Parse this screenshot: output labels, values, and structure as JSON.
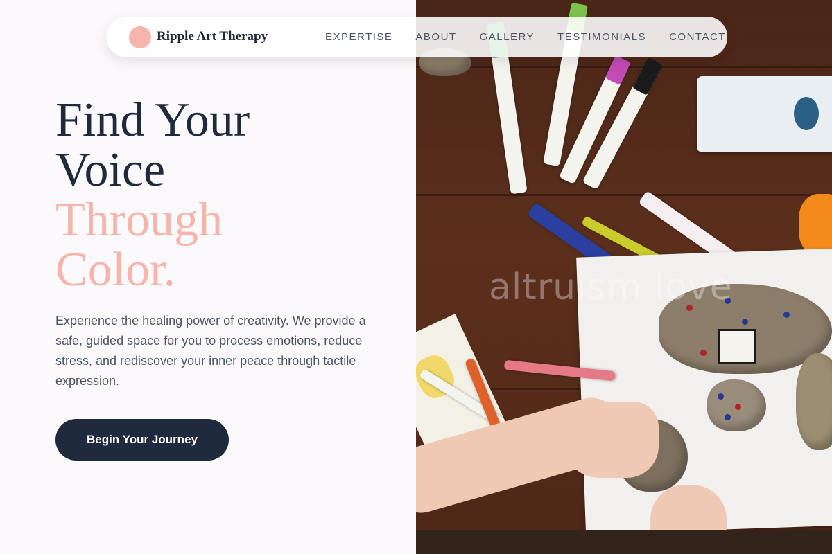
{
  "brand": {
    "name": "Ripple Art Therapy"
  },
  "nav": {
    "links": [
      "EXPERTISE",
      "ABOUT",
      "GALLERY",
      "TESTIMONIALS",
      "CONTACT"
    ]
  },
  "hero": {
    "title_line1": "Find Your",
    "title_line2": "Voice",
    "title_accent_line1": "Through",
    "title_accent_line2": "Color.",
    "description": "Experience the healing power of creativity. We provide a safe, guided space for you to process emotions, reduce stress, and rediscover your inner peace through tactile expression.",
    "cta_label": "Begin Your Journey"
  },
  "image": {
    "watermark": "altruism love"
  },
  "colors": {
    "accent_pink": "#f6b4aa",
    "navy": "#1f2a3d",
    "background": "#fbf9fc"
  }
}
